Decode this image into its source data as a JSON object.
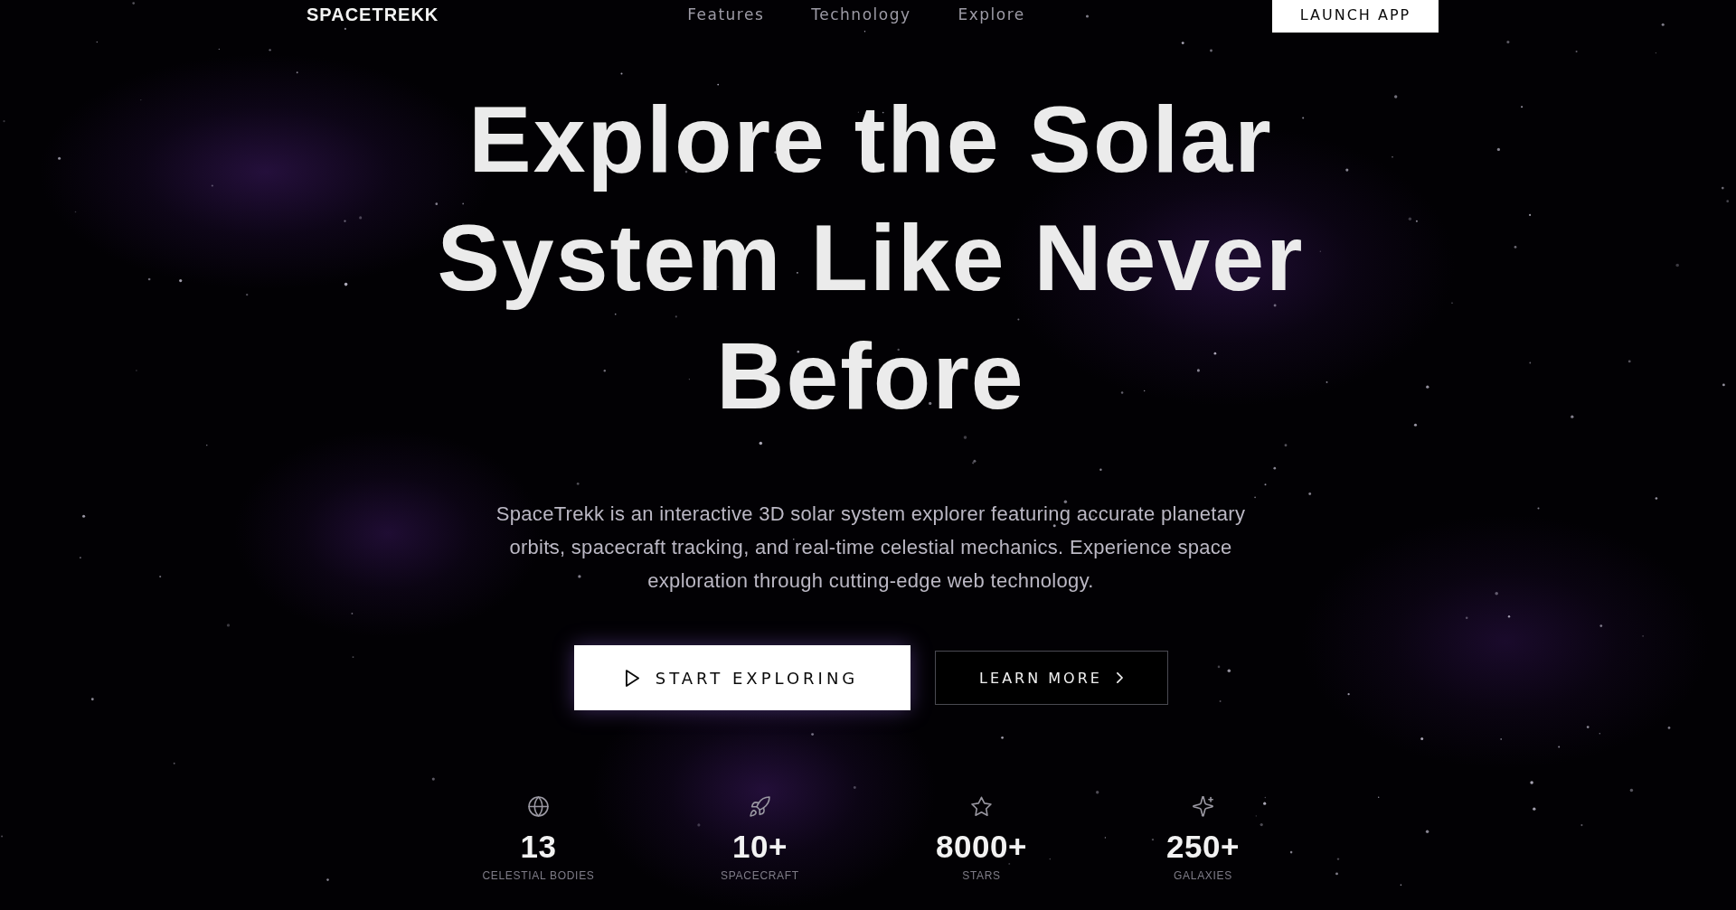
{
  "nav": {
    "logo": "SPACETREKK",
    "links": [
      {
        "label": "Features"
      },
      {
        "label": "Technology"
      },
      {
        "label": "Explore"
      }
    ],
    "cta": "LAUNCH APP"
  },
  "hero": {
    "title": "Explore the Solar System Like Never Before",
    "description": "SpaceTrekk is an interactive 3D solar system explorer featuring accurate planetary orbits, spacecraft tracking, and real-time celestial mechanics. Experience space exploration through cutting-edge web technology.",
    "buttons": [
      {
        "kind": "primary",
        "label": "START EXPLORING"
      },
      {
        "kind": "secondary",
        "label": "LEARN MORE"
      }
    ]
  },
  "stats": [
    {
      "value": "13",
      "label": "CELESTIAL BODIES"
    },
    {
      "value": "10+",
      "label": "SPACECRAFT"
    },
    {
      "value": "8000+",
      "label": "STARS"
    },
    {
      "value": "250+",
      "label": "GALAXIES"
    }
  ]
}
